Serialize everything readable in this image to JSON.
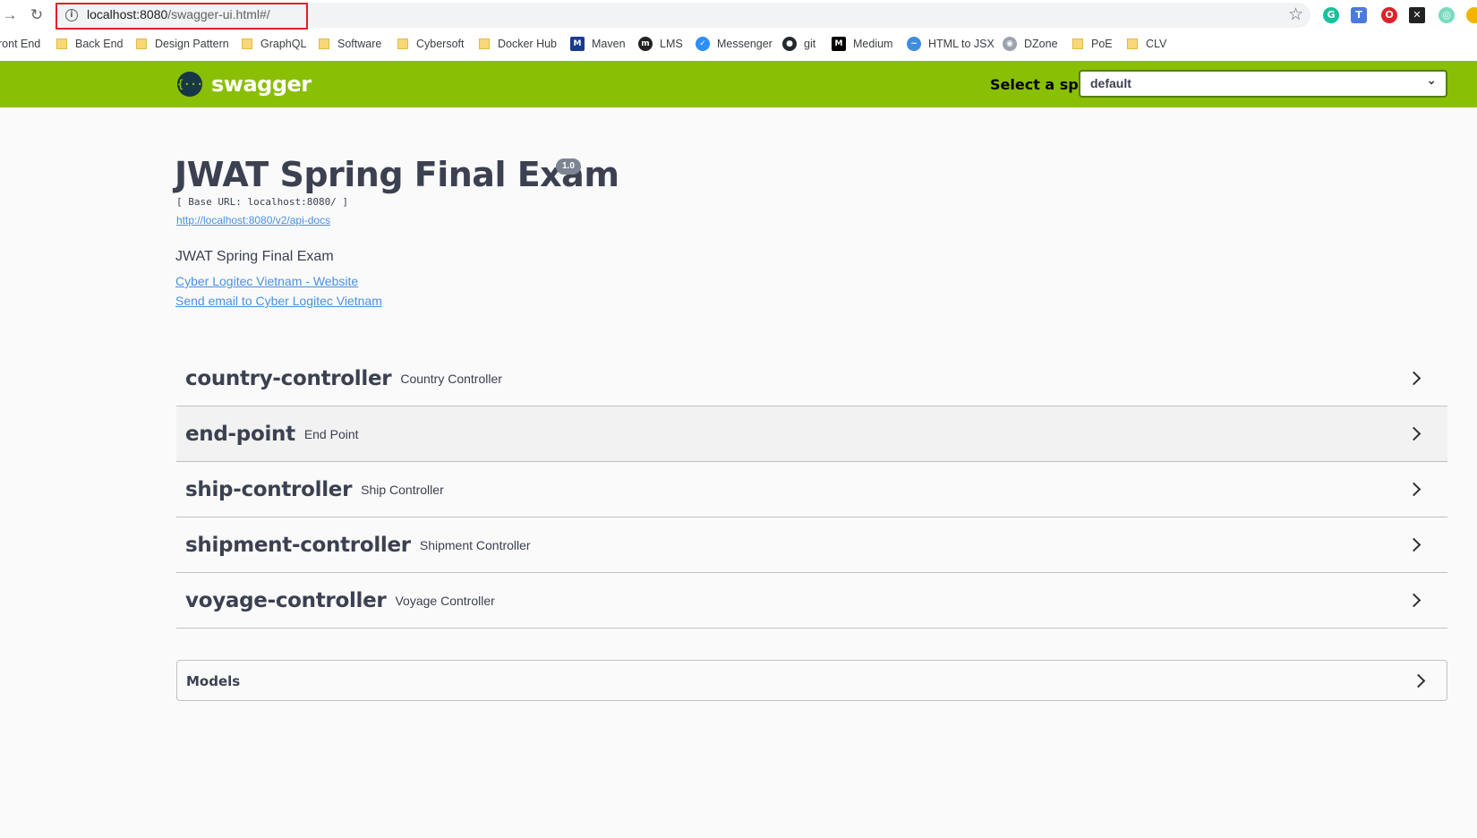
{
  "browser": {
    "url_host": "localhost:8080",
    "url_path": "/swagger-ui.html#/",
    "bookmarks": [
      {
        "label": "ront End",
        "type": "none"
      },
      {
        "label": "Back End",
        "type": "folder"
      },
      {
        "label": "Design Pattern",
        "type": "folder"
      },
      {
        "label": "GraphQL",
        "type": "folder"
      },
      {
        "label": "Software",
        "type": "folder"
      },
      {
        "label": "Cybersoft",
        "type": "folder"
      },
      {
        "label": "Docker Hub",
        "type": "folder"
      },
      {
        "label": "Maven",
        "type": "maven-icon"
      },
      {
        "label": "LMS",
        "type": "lms-icon"
      },
      {
        "label": "Messenger",
        "type": "messenger-icon"
      },
      {
        "label": "git",
        "type": "github-icon"
      },
      {
        "label": "Medium",
        "type": "medium-icon"
      },
      {
        "label": "HTML to JSX",
        "type": "pulse-icon"
      },
      {
        "label": "DZone",
        "type": "dzone-icon"
      },
      {
        "label": "PoE",
        "type": "folder"
      },
      {
        "label": "CLV",
        "type": "folder"
      }
    ]
  },
  "topbar": {
    "logo_text": "swagger",
    "logo_glyph": "{···}",
    "spec_label": "Select a spec",
    "spec_value": "default"
  },
  "info": {
    "title": "JWAT Spring Final Exam",
    "version": "1.0",
    "base_url": "[ Base URL: localhost:8080/ ]",
    "api_docs_link": "http://localhost:8080/v2/api-docs",
    "description": "JWAT Spring Final Exam",
    "website_link": "Cyber Logitec Vietnam - Website",
    "email_link": "Send email to Cyber Logitec Vietnam"
  },
  "tags": [
    {
      "name": "country-controller",
      "desc": "Country Controller"
    },
    {
      "name": "end-point",
      "desc": "End Point"
    },
    {
      "name": "ship-controller",
      "desc": "Ship Controller"
    },
    {
      "name": "shipment-controller",
      "desc": "Shipment Controller"
    },
    {
      "name": "voyage-controller",
      "desc": "Voyage Controller"
    }
  ],
  "models": {
    "title": "Models"
  },
  "colors": {
    "topbar": "#89bf04",
    "link": "#4990e2",
    "text": "#3b4151",
    "highlight_box": "#e0202a"
  }
}
